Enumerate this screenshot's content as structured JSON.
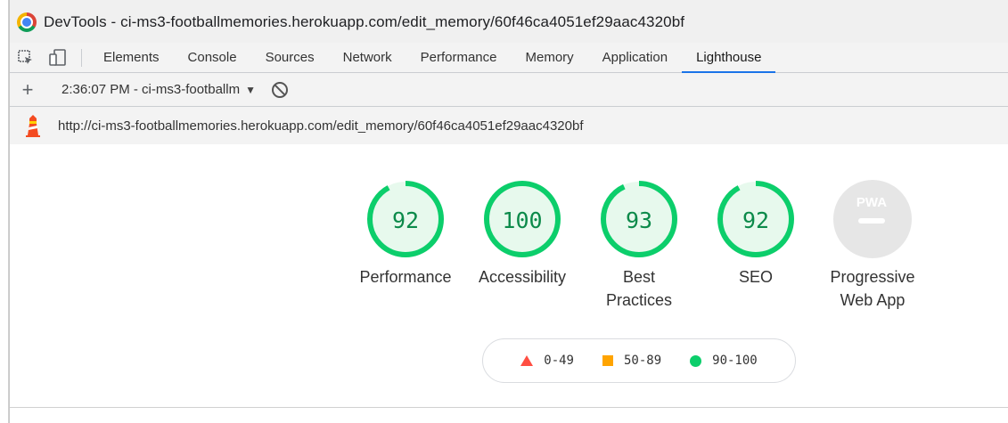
{
  "window": {
    "title": "DevTools - ci-ms3-footballmemories.herokuapp.com/edit_memory/60f46ca4051ef29aac4320bf"
  },
  "tabs": [
    {
      "label": "Elements"
    },
    {
      "label": "Console"
    },
    {
      "label": "Sources"
    },
    {
      "label": "Network"
    },
    {
      "label": "Performance"
    },
    {
      "label": "Memory"
    },
    {
      "label": "Application"
    },
    {
      "label": "Lighthouse",
      "active": true
    }
  ],
  "report": {
    "selected": "2:36:07 PM - ci-ms3-footballm",
    "url": "http://ci-ms3-footballmemories.herokuapp.com/edit_memory/60f46ca4051ef29aac4320bf"
  },
  "scores": [
    {
      "label": "Performance",
      "value": "92",
      "score": 0.92
    },
    {
      "label": "Accessibility",
      "value": "100",
      "score": 1.0
    },
    {
      "label": "Best Practices",
      "value": "93",
      "score": 0.93
    },
    {
      "label": "SEO",
      "value": "92",
      "score": 0.92
    },
    {
      "label": "Progressive Web App",
      "value": "",
      "badge": "PWA"
    }
  ],
  "legend": {
    "fail": "0-49",
    "average": "50-89",
    "pass": "90-100"
  },
  "colors": {
    "pass": "#0cce6b",
    "pass_bg": "#e7f9ed",
    "pass_text": "#0c8a4a",
    "average": "#ffa400",
    "fail": "#ff4e42",
    "accent": "#1a73e8"
  }
}
